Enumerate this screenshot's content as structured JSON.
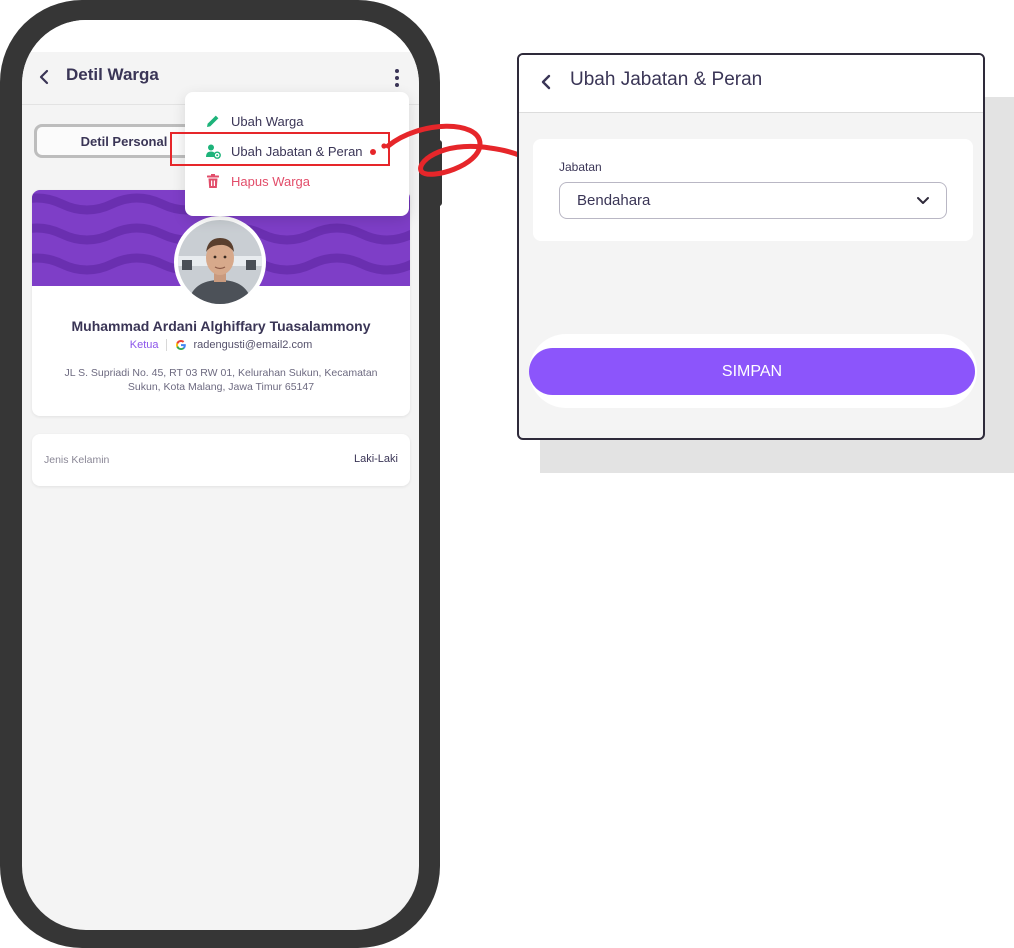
{
  "left_screen": {
    "appbar": {
      "title": "Detil Warga"
    },
    "tab_label": "Detil Personal",
    "menu": {
      "items": [
        {
          "label": "Ubah Warga",
          "icon": "pencil-icon"
        },
        {
          "label": "Ubah Jabatan & Peran",
          "icon": "user-settings-icon"
        },
        {
          "label": "Hapus Warga",
          "icon": "trash-icon"
        }
      ]
    },
    "profile": {
      "name": "Muhammad Ardani Alghiffary Tuasalammony",
      "role": "Ketua",
      "email": "radengusti@email2.com",
      "address": "JL S. Supriadi No. 45, RT 03 RW 01, Kelurahan Sukun, Kecamatan Sukun, Kota Malang, Jawa Timur 65147"
    },
    "gender": {
      "label": "Jenis Kelamin",
      "value": "Laki-Laki"
    }
  },
  "right_screen": {
    "title": "Ubah Jabatan & Peran",
    "field_label": "Jabatan",
    "selected_value": "Bendahara",
    "save_label": "SIMPAN"
  },
  "colors": {
    "accent": "#8c55fb",
    "banner": "#7e3ec7",
    "menu_icon_green": "#1db37a",
    "delete_red": "#e24d6a",
    "annotation_red": "#e6262a",
    "text_dark": "#3a3556"
  }
}
